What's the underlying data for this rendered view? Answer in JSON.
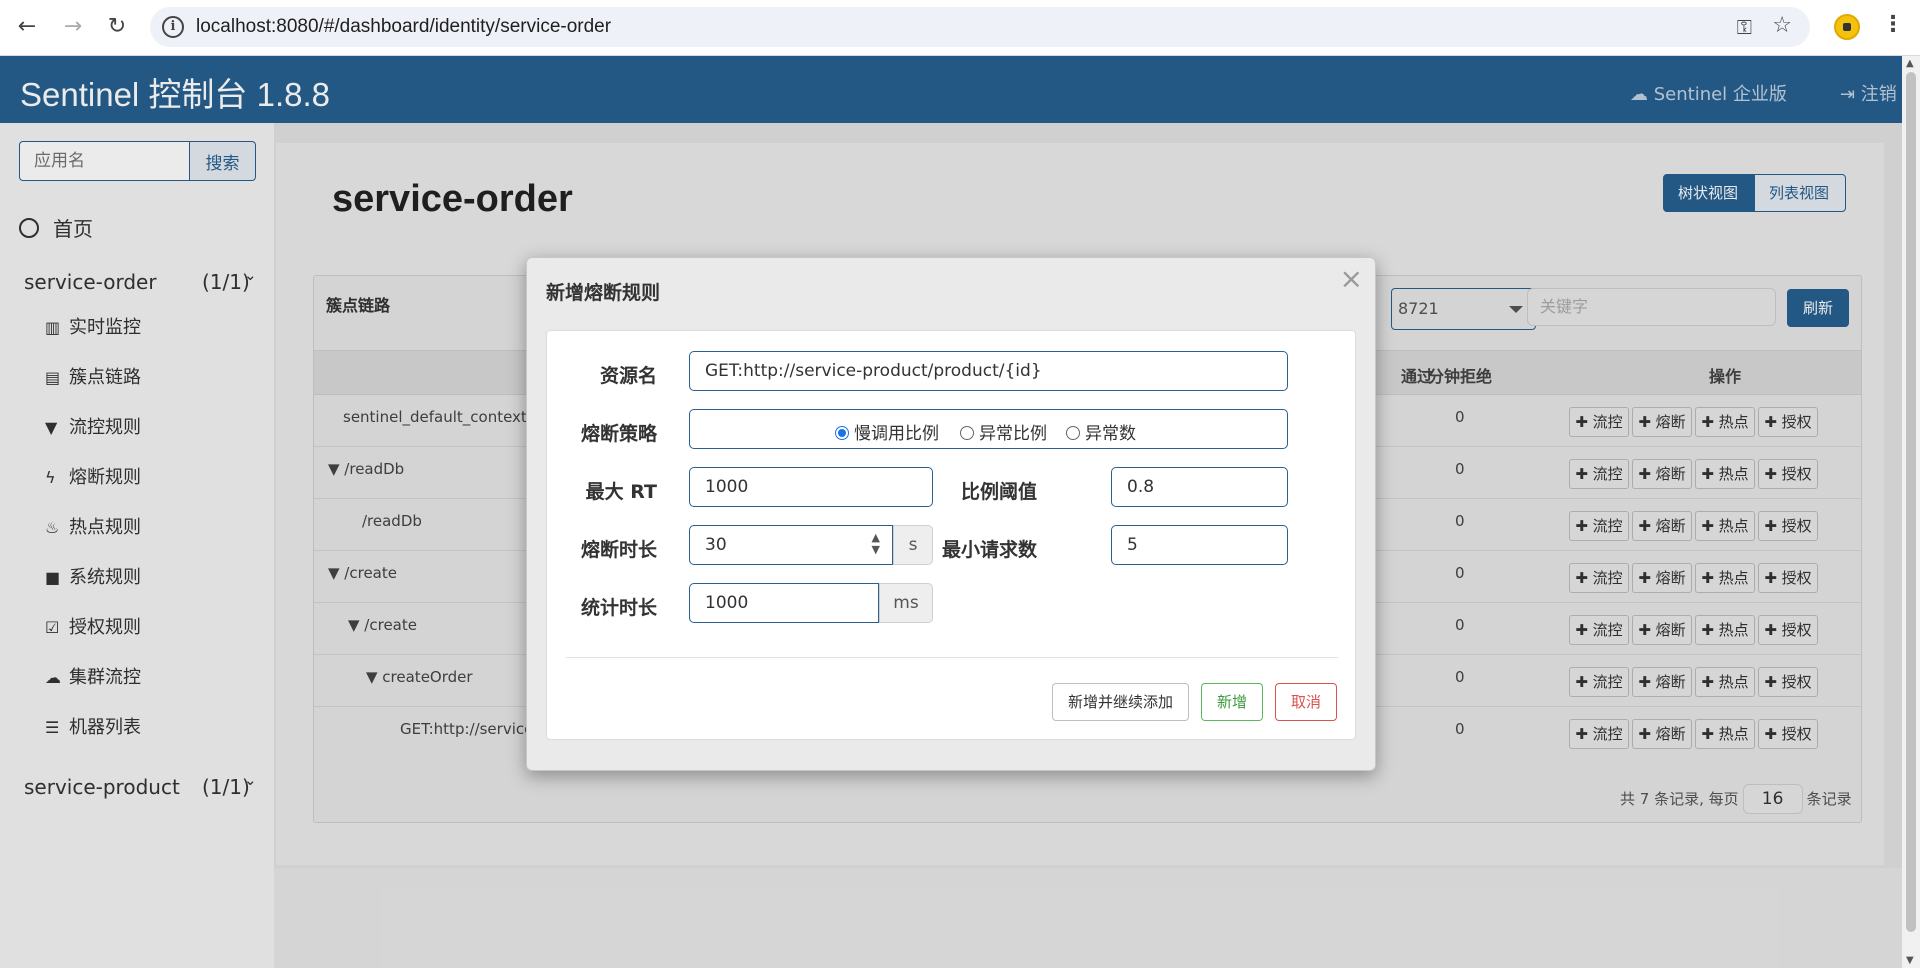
{
  "browser": {
    "url": "localhost:8080/#/dashboard/identity/service-order",
    "back_icon": "←",
    "forward_icon": "→",
    "reload_icon": "↻",
    "info_icon": "i",
    "key_icon": "⚿",
    "star_icon": "☆",
    "menu_icon": "⋮"
  },
  "header": {
    "brand": "Sentinel 控制台 1.8.8",
    "enterprise": "☁ Sentinel 企业版",
    "logout": "⇥ 注销"
  },
  "sidebar": {
    "search_placeholder": "应用名",
    "search_button": "搜索",
    "home": "首页",
    "apps": [
      {
        "name": "service-order",
        "count": "(1/1)"
      },
      {
        "name": "service-product",
        "count": "(1/1)"
      }
    ],
    "menu": [
      {
        "icon": "📊",
        "label": "实时监控"
      },
      {
        "icon": "▤",
        "label": "簇点链路"
      },
      {
        "icon": "⏷",
        "label": "流控规则"
      },
      {
        "icon": "⚡",
        "label": "熔断规则"
      },
      {
        "icon": "♨",
        "label": "热点规则"
      },
      {
        "icon": "🔒",
        "label": "系统规则"
      },
      {
        "icon": "☑",
        "label": "授权规则"
      },
      {
        "icon": "☁",
        "label": "集群流控"
      },
      {
        "icon": "☰",
        "label": "机器列表"
      }
    ]
  },
  "main": {
    "title": "service-order",
    "view_tree": "树状视图",
    "view_list": "列表视图",
    "table": {
      "title": "簇点链路",
      "port_value": "8721",
      "keyword_placeholder": "关键字",
      "refresh": "刷新",
      "col_pass": "通过",
      "col_reject": "分钟拒绝",
      "col_ops": "操作",
      "rows": [
        {
          "name": "sentinel_default_context",
          "reject": "0"
        },
        {
          "name": "▼ /readDb",
          "reject": "0"
        },
        {
          "name": "/readDb",
          "reject": "0"
        },
        {
          "name": "▼ /create",
          "reject": "0"
        },
        {
          "name": "▼ /create",
          "reject": "0"
        },
        {
          "name": "▼ createOrder",
          "reject": "0"
        },
        {
          "name": "GET:http://service-p",
          "reject": "0"
        }
      ],
      "ops": [
        "✚ 流控",
        "✚ 熔断",
        "✚ 热点",
        "✚ 授权"
      ],
      "pager_prefix": "共 7 条记录, 每页",
      "page_size": "16",
      "pager_suffix": "条记录"
    }
  },
  "modal": {
    "title": "新增熔断规则",
    "close": "×",
    "resource_label": "资源名",
    "resource_value": "GET:http://service-product/product/{id}",
    "strategy_label": "熔断策略",
    "strategies": [
      "慢调用比例",
      "异常比例",
      "异常数"
    ],
    "selected_strategy": "慢调用比例",
    "max_rt_label": "最大 RT",
    "max_rt_value": "1000",
    "ratio_label": "比例阈值",
    "ratio_value": "0.8",
    "duration_label": "熔断时长",
    "duration_value": "30",
    "duration_unit": "s",
    "min_req_label": "最小请求数",
    "min_req_value": "5",
    "stat_label": "统计时长",
    "stat_value": "1000",
    "stat_unit": "ms",
    "btn_add_continue": "新增并继续添加",
    "btn_add": "新增",
    "btn_cancel": "取消"
  }
}
